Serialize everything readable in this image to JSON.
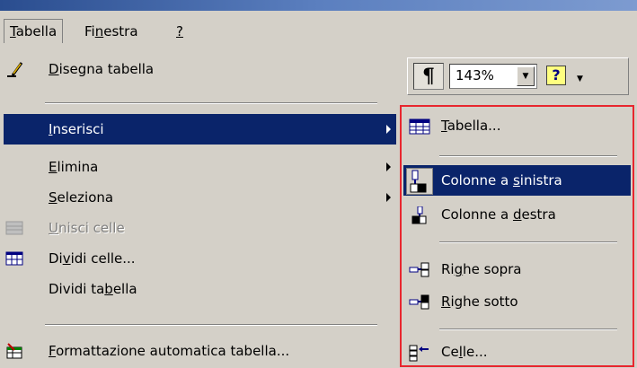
{
  "menubar": {
    "items": [
      {
        "label": "Tabella",
        "accel": "T"
      },
      {
        "label": "Finestra",
        "accel": "n"
      },
      {
        "label": "?",
        "accel": "?"
      }
    ]
  },
  "toolbar": {
    "zoom": "143%"
  },
  "menu": {
    "items": [
      {
        "label": "Disegna tabella",
        "icon": "pencil-icon"
      },
      {
        "label": "Inserisci",
        "icon": "",
        "submenu": true,
        "selected": true
      },
      {
        "label": "Elimina",
        "submenu": true
      },
      {
        "label": "Seleziona",
        "submenu": true
      },
      {
        "label": "Unisci celle",
        "icon": "merge-cells-icon",
        "disabled": true
      },
      {
        "label": "Dividi celle...",
        "icon": "split-cells-icon"
      },
      {
        "label": "Dividi tabella"
      },
      {
        "label": "Formattazione automatica tabella...",
        "icon": "autoformat-icon"
      }
    ]
  },
  "submenu": {
    "items": [
      {
        "label": "Tabella...",
        "icon": "table-icon"
      },
      {
        "label": "Colonne a sinistra",
        "icon": "insert-columns-left-icon",
        "selected": true
      },
      {
        "label": "Colonne a destra",
        "icon": "insert-columns-right-icon"
      },
      {
        "label": "Righe sopra",
        "icon": "insert-rows-above-icon"
      },
      {
        "label": "Righe sotto",
        "icon": "insert-rows-below-icon"
      },
      {
        "label": "Celle...",
        "icon": "insert-cells-icon"
      }
    ]
  },
  "colors": {
    "selection": "#0a246a",
    "highlight_border": "#e8262e",
    "menu_bg": "#d4d0c8"
  }
}
